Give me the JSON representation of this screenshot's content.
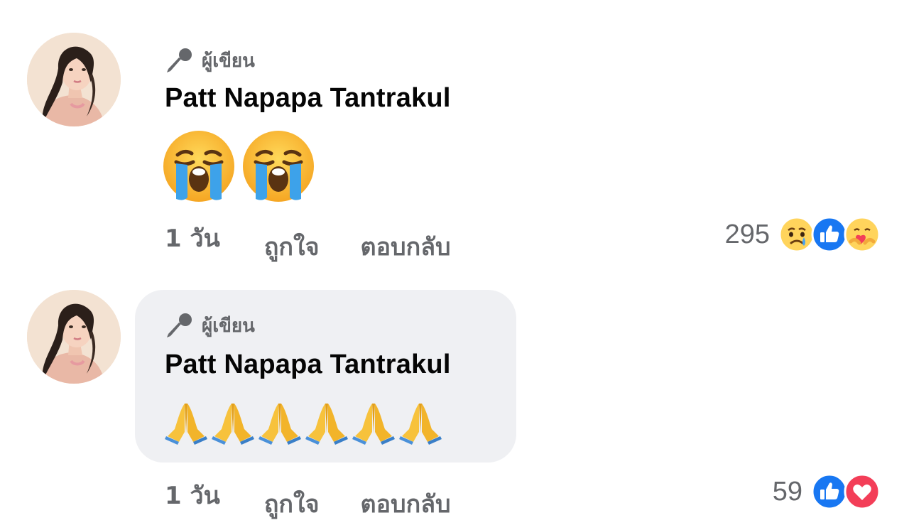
{
  "comments": [
    {
      "badge": "ผู้เขียน",
      "author": "Patt Napapa Tantrakul",
      "content_emoji": [
        "loudly-crying-face",
        "loudly-crying-face"
      ],
      "time": "1 วัน",
      "like_label": "ถูกใจ",
      "reply_label": "ตอบกลับ",
      "reaction_count": "295",
      "reaction_icons": [
        "sad-reaction-icon",
        "like-reaction-icon",
        "care-reaction-icon"
      ]
    },
    {
      "badge": "ผู้เขียน",
      "author": "Patt Napapa Tantrakul",
      "content_emoji": [
        "folded-hands",
        "folded-hands",
        "folded-hands",
        "folded-hands",
        "folded-hands",
        "folded-hands"
      ],
      "time": "1 วัน",
      "like_label": "ถูกใจ",
      "reply_label": "ตอบกลับ",
      "reaction_count": "59",
      "reaction_icons": [
        "like-reaction-icon",
        "love-reaction-icon"
      ]
    }
  ],
  "colors": {
    "meta_text": "#65676b",
    "bubble_bg": "#eff0f3",
    "like_blue": "#1877f2",
    "love_red": "#f33e58"
  }
}
